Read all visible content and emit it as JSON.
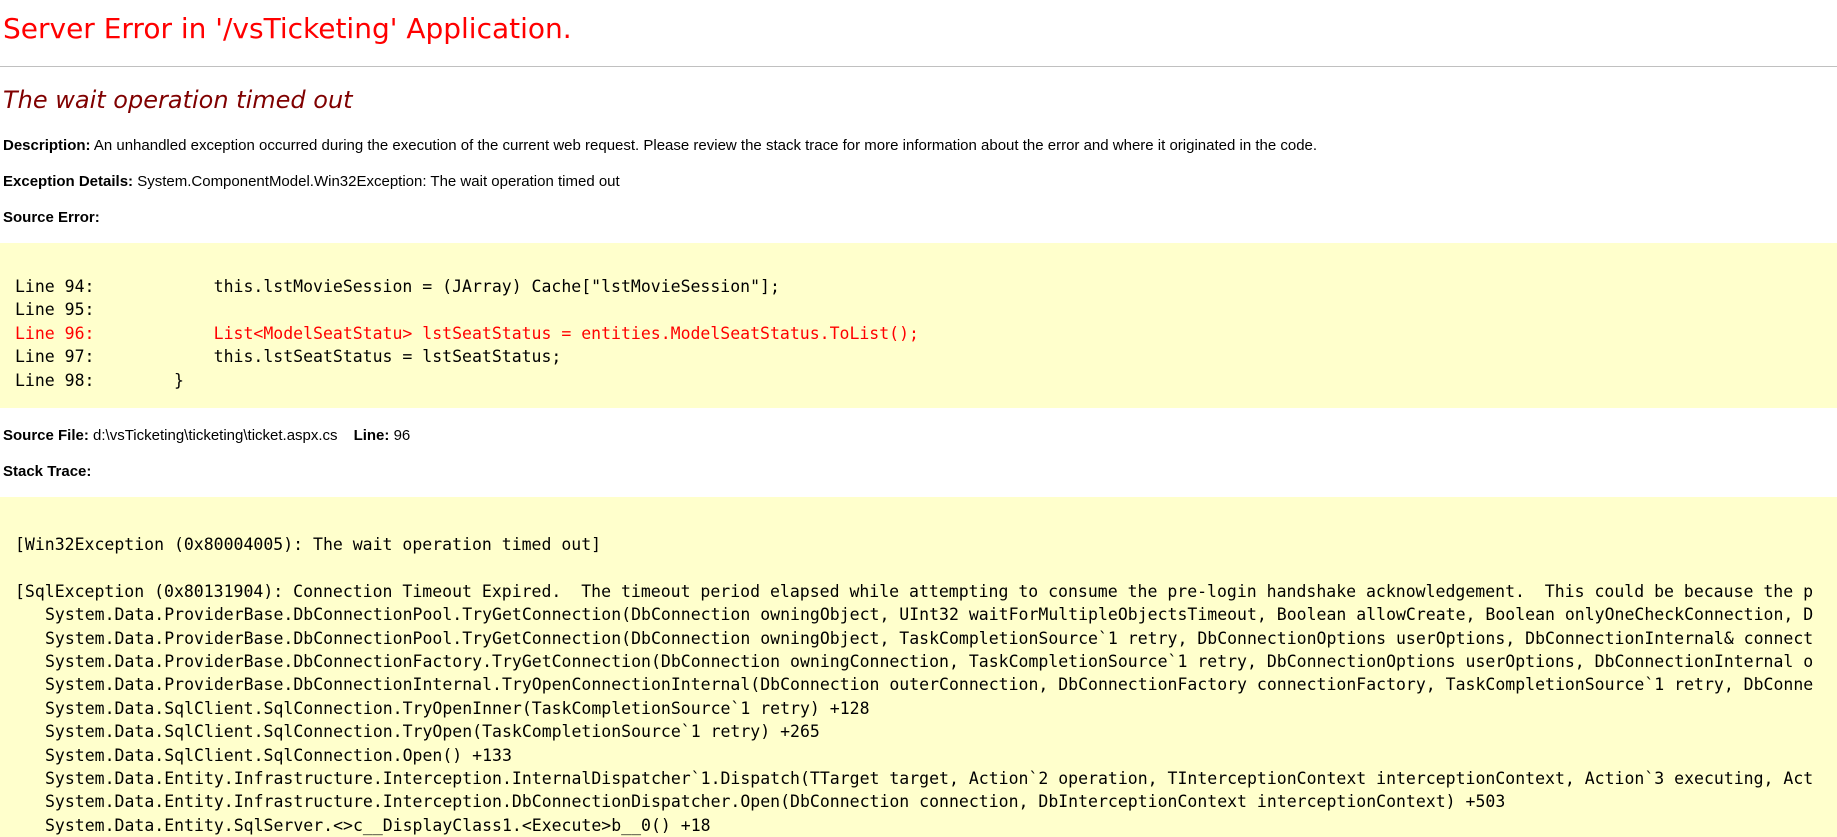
{
  "header": {
    "title": "Server Error in '/vsTicketing' Application.",
    "error_message": "The wait operation timed out"
  },
  "description": {
    "label": "Description:",
    "text": " An unhandled exception occurred during the execution of the current web request. Please review the stack trace for more information about the error and where it originated in the code."
  },
  "exception_details": {
    "label": "Exception Details:",
    "text": " System.ComponentModel.Win32Exception: The wait operation timed out"
  },
  "source_error": {
    "label": "Source Error:",
    "lines": [
      {
        "text": "Line 94:            this.lstMovieSession = (JArray) Cache[\"lstMovieSession\"];",
        "highlight": false
      },
      {
        "text": "Line 95:",
        "highlight": false
      },
      {
        "text": "Line 96:            List<ModelSeatStatu> lstSeatStatus = entities.ModelSeatStatus.ToList();",
        "highlight": true
      },
      {
        "text": "Line 97:            this.lstSeatStatus = lstSeatStatus;",
        "highlight": false
      },
      {
        "text": "Line 98:        }",
        "highlight": false
      }
    ]
  },
  "source_file": {
    "label": "Source File:",
    "path": " d:\\vsTicketing\\ticketing\\ticket.aspx.cs",
    "line_label": "Line:",
    "line_value": " 96"
  },
  "stack_trace": {
    "label": "Stack Trace:",
    "win32_exception": "[Win32Exception (0x80004005): The wait operation timed out]",
    "sql_exception": "[SqlException (0x80131904): Connection Timeout Expired.  The timeout period elapsed while attempting to consume the pre-login handshake acknowledgement.  This could be because the p",
    "frames": [
      "System.Data.ProviderBase.DbConnectionPool.TryGetConnection(DbConnection owningObject, UInt32 waitForMultipleObjectsTimeout, Boolean allowCreate, Boolean onlyOneCheckConnection, D",
      "System.Data.ProviderBase.DbConnectionPool.TryGetConnection(DbConnection owningObject, TaskCompletionSource`1 retry, DbConnectionOptions userOptions, DbConnectionInternal& connect",
      "System.Data.ProviderBase.DbConnectionFactory.TryGetConnection(DbConnection owningConnection, TaskCompletionSource`1 retry, DbConnectionOptions userOptions, DbConnectionInternal o",
      "System.Data.ProviderBase.DbConnectionInternal.TryOpenConnectionInternal(DbConnection outerConnection, DbConnectionFactory connectionFactory, TaskCompletionSource`1 retry, DbConne",
      "System.Data.SqlClient.SqlConnection.TryOpenInner(TaskCompletionSource`1 retry) +128",
      "System.Data.SqlClient.SqlConnection.TryOpen(TaskCompletionSource`1 retry) +265",
      "System.Data.SqlClient.SqlConnection.Open() +133",
      "System.Data.Entity.Infrastructure.Interception.InternalDispatcher`1.Dispatch(TTarget target, Action`2 operation, TInterceptionContext interceptionContext, Action`3 executing, Act",
      "System.Data.Entity.Infrastructure.Interception.DbConnectionDispatcher.Open(DbConnection connection, DbInterceptionContext interceptionContext) +503",
      "System.Data.Entity.SqlServer.<>c__DisplayClass1.<Execute>b__0() +18"
    ]
  },
  "colors": {
    "title": "#ff0000",
    "error_message": "#800000",
    "code_background": "#ffffcc",
    "highlight_line": "#ff0000"
  }
}
